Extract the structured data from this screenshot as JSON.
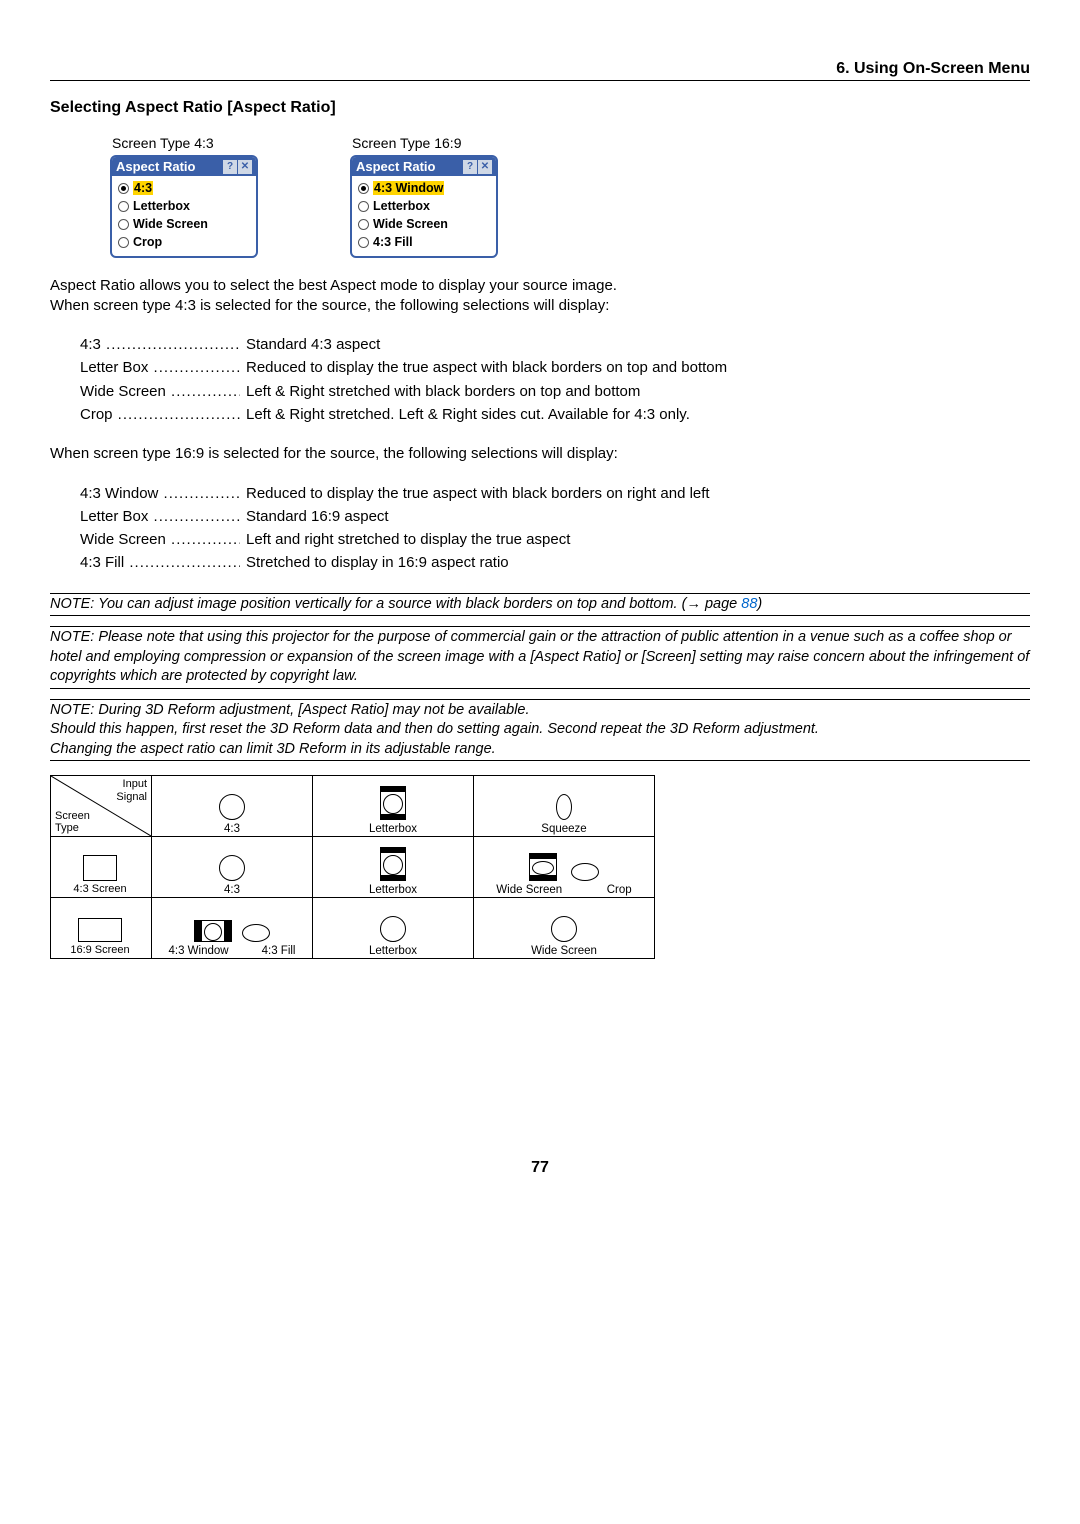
{
  "header": {
    "section": "6. Using On-Screen Menu"
  },
  "subheader": "Selecting Aspect Ratio [Aspect Ratio]",
  "dialogs": {
    "left": {
      "caption": "Screen Type 4:3",
      "title": "Aspect Ratio",
      "options": [
        "4:3",
        "Letterbox",
        "Wide Screen",
        "Crop"
      ],
      "selected": 0
    },
    "right": {
      "caption": "Screen Type 16:9",
      "title": "Aspect Ratio",
      "options": [
        "4:3 Window",
        "Letterbox",
        "Wide Screen",
        "4:3 Fill"
      ],
      "selected": 0
    }
  },
  "intro": {
    "line1": "Aspect Ratio allows you to select the best Aspect mode to display your source image.",
    "line2": "When screen type 4:3 is selected for the source, the following selections will display:"
  },
  "defs43": [
    {
      "term": "4:3",
      "desc": "Standard 4:3 aspect"
    },
    {
      "term": "Letter Box",
      "desc": "Reduced to display the true aspect with black borders on top and bottom"
    },
    {
      "term": "Wide Screen",
      "desc": "Left & Right stretched with black borders on top and bottom"
    },
    {
      "term": "Crop",
      "desc": "Left & Right stretched. Left & Right sides cut. Available for 4:3 only."
    }
  ],
  "mid": "When screen type 16:9 is selected for the source, the following selections will display:",
  "defs169": [
    {
      "term": "4:3 Window",
      "desc": "Reduced to display the true aspect with black borders on right and left"
    },
    {
      "term": "Letter Box",
      "desc": "Standard 16:9 aspect"
    },
    {
      "term": "Wide Screen",
      "desc": "Left and right stretched to display the true aspect"
    },
    {
      "term": "4:3 Fill",
      "desc": "Stretched to display in 16:9 aspect ratio"
    }
  ],
  "notes": {
    "n1_a": "NOTE: You can adjust image position vertically for a source with black borders on top and bottom. (→ page ",
    "n1_page": "88",
    "n1_b": ")",
    "n2": "NOTE: Please note that using this projector for the purpose of commercial gain or the attraction of public attention in a venue such as a coffee shop or hotel and employing compression or expansion of the screen image with a [Aspect Ratio] or [Screen] setting may raise concern about the infringement of copyrights which are protected by copyright law.",
    "n3": "NOTE: During 3D Reform adjustment, [Aspect Ratio] may not be available.\nShould this happen, first reset the 3D Reform data and then do setting again. Second repeat the 3D Reform adjustment.\nChanging the aspect ratio can limit 3D Reform in its adjustable range."
  },
  "table": {
    "corner_top": "Input\nSignal",
    "corner_bot": "Screen\nType",
    "col_headers": [
      "4:3",
      "Letterbox",
      "Squeeze"
    ],
    "rows": [
      {
        "label": "4:3 Screen",
        "cells": [
          {
            "captions": [
              "4:3"
            ]
          },
          {
            "captions": [
              "Letterbox"
            ]
          },
          {
            "captions": [
              "Wide Screen",
              "Crop"
            ]
          }
        ]
      },
      {
        "label": "16:9 Screen",
        "cells": [
          {
            "captions": [
              "4:3 Window",
              "4:3 Fill"
            ]
          },
          {
            "captions": [
              "Letterbox"
            ]
          },
          {
            "captions": [
              "Wide Screen"
            ]
          }
        ]
      }
    ]
  },
  "page_number": "77"
}
